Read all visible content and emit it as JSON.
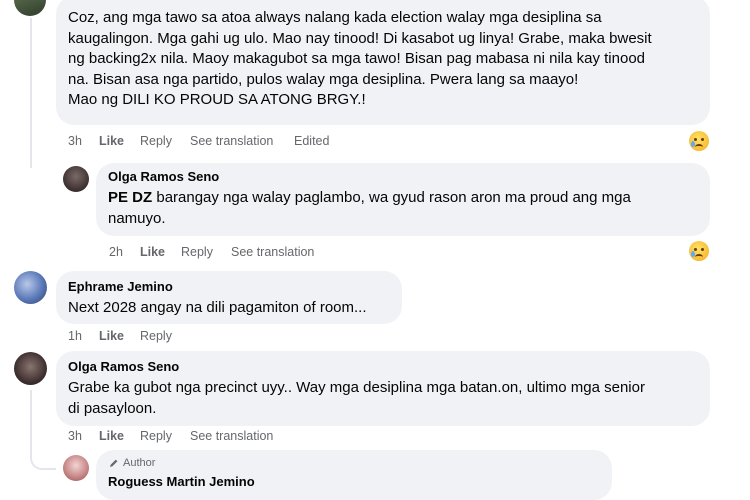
{
  "comments": [
    {
      "text": "Coz, ang mga tawo sa atoa always nalang kada election walay mga desiplina sa\nkaugalingon. Mga gahi ug ulo. Mao nay tinood! Di kasabot ug linya! Grabe, maka bwesit\nng backing2x nila. Maoy makagubot sa mga tawo! Bisan pag mabasa ni nila kay tinood\nna. Bisan asa nga partido, pulos walay mga desiplina. Pwera lang sa maayo!\nMao ng DILI KO PROUD SA ATONG BRGY.!",
      "time": "3h",
      "like": "Like",
      "reply": "Reply",
      "translate": "See translation",
      "edited": "Edited",
      "reaction": "sad-face-icon"
    },
    {
      "author": "Olga Ramos Seno",
      "text_bold": "PE DZ",
      "text": " barangay nga walay paglambo, wa gyud rason aron ma proud ang mga\nnamuyo.",
      "time": "2h",
      "like": "Like",
      "reply": "Reply",
      "translate": "See translation",
      "reaction": "sad-face-icon"
    },
    {
      "author": "Ephrame Jemino",
      "text": "Next 2028 angay na dili pagamiton of room...",
      "time": "1h",
      "like": "Like",
      "reply": "Reply"
    },
    {
      "author": "Olga Ramos Seno",
      "text": "Grabe ka gubot nga precinct uyy.. Way mga desiplina mga batan.on, ultimo mga senior\ndi pasayloon.",
      "time": "3h",
      "like": "Like",
      "reply": "Reply",
      "translate": "See translation"
    },
    {
      "badge": "Author",
      "author": "Roguess Martin Jemino"
    }
  ]
}
